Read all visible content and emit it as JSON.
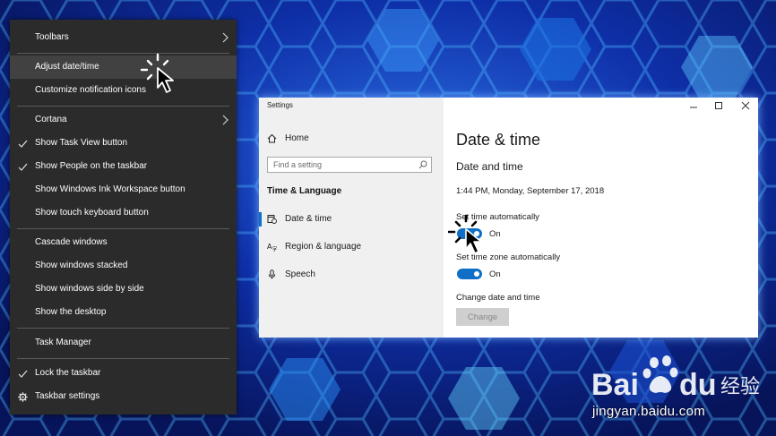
{
  "context_menu": {
    "items": [
      {
        "label": "Toolbars"
      },
      {
        "label": "Adjust date/time"
      },
      {
        "label": "Customize notification icons"
      },
      {
        "label": "Cortana"
      },
      {
        "label": "Show Task View button"
      },
      {
        "label": "Show People on the taskbar"
      },
      {
        "label": "Show Windows Ink Workspace button"
      },
      {
        "label": "Show touch keyboard button"
      },
      {
        "label": "Cascade windows"
      },
      {
        "label": "Show windows stacked"
      },
      {
        "label": "Show windows side by side"
      },
      {
        "label": "Show the desktop"
      },
      {
        "label": "Task Manager"
      },
      {
        "label": "Lock the taskbar"
      },
      {
        "label": "Taskbar settings"
      }
    ]
  },
  "settings": {
    "window_title": "Settings",
    "sidebar": {
      "home": "Home",
      "search_placeholder": "Find a setting",
      "section": "Time & Language",
      "items": [
        {
          "label": "Date & time"
        },
        {
          "label": "Region & language"
        },
        {
          "label": "Speech"
        }
      ]
    },
    "main": {
      "title": "Date & time",
      "subtitle": "Date and time",
      "current_datetime": "1:44 PM, Monday, September 17, 2018",
      "set_time_auto_label": "Set time automatically",
      "set_time_auto_state": "On",
      "set_tz_auto_label": "Set time zone automatically",
      "set_tz_auto_state": "On",
      "change_label": "Change date and time",
      "change_button": "Change"
    }
  },
  "watermark": {
    "logo_text": "Bai du 经验",
    "url": "jingyan.baidu.com"
  },
  "colors": {
    "menu_bg": "#2b2b2b",
    "menu_hover": "#414141",
    "accent": "#0f6fc6",
    "background": "#0a1a6e"
  }
}
